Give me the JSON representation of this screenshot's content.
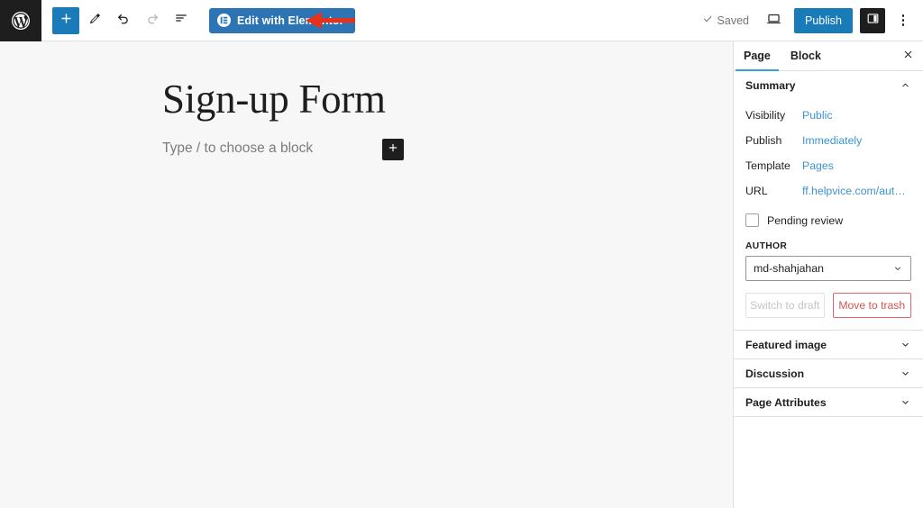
{
  "header": {
    "wp_logo": "wordpress-logo",
    "tools": [
      {
        "name": "add-block-button",
        "icon": "plus-icon",
        "label": "Add block",
        "state": "active"
      },
      {
        "name": "tools-button",
        "icon": "pencil-icon",
        "label": "Tools",
        "state": "normal"
      },
      {
        "name": "undo-button",
        "icon": "undo-icon",
        "label": "Undo",
        "state": "normal"
      },
      {
        "name": "redo-button",
        "icon": "redo-icon",
        "label": "Redo",
        "state": "disabled"
      },
      {
        "name": "list-view-button",
        "icon": "list-view-icon",
        "label": "Document overview",
        "state": "normal"
      }
    ],
    "elementor_button": "Edit with Elementor",
    "elementor_badge": "E",
    "saved_label": "Saved",
    "saved_icon": "check-icon",
    "preview_icon": "desktop-preview-icon",
    "publish_label": "Publish",
    "settings_icon": "sidebar-toggle-icon",
    "options_icon": "kebab-menu-icon"
  },
  "annotation": {
    "type": "arrow",
    "color": "#e8311a",
    "points_to": "Edit with Elementor"
  },
  "canvas": {
    "post_title": "Sign-up Form",
    "paragraph_placeholder": "Type / to choose a block",
    "inserter_icon": "plus-icon"
  },
  "sidebar": {
    "tabs": [
      {
        "label": "Page",
        "active": true
      },
      {
        "label": "Block",
        "active": false
      }
    ],
    "close_icon": "close-icon",
    "summary": {
      "title": "Summary",
      "chevron": "chevron-up-icon",
      "rows": [
        {
          "label": "Visibility",
          "value": "Public"
        },
        {
          "label": "Publish",
          "value": "Immediately"
        },
        {
          "label": "Template",
          "value": "Pages"
        },
        {
          "label": "URL",
          "value": "ff.helpvice.com/auto-..."
        }
      ],
      "pending_review_label": "Pending review",
      "pending_review_checked": false,
      "author_label": "AUTHOR",
      "author_value": "md-shahjahan",
      "author_chevron": "chevron-down-icon",
      "switch_to_draft_label": "Switch to draft",
      "move_to_trash_label": "Move to trash"
    },
    "panels": [
      {
        "title": "Featured image",
        "chevron": "chevron-down-icon"
      },
      {
        "title": "Discussion",
        "chevron": "chevron-down-icon"
      },
      {
        "title": "Page Attributes",
        "chevron": "chevron-down-icon"
      }
    ]
  },
  "colors": {
    "accent_blue": "#1a7bb9",
    "elementor_blue": "#2d74b5",
    "link_blue": "#3c93d4",
    "danger_red": "#d9534f",
    "arrow_red": "#e8311a"
  }
}
